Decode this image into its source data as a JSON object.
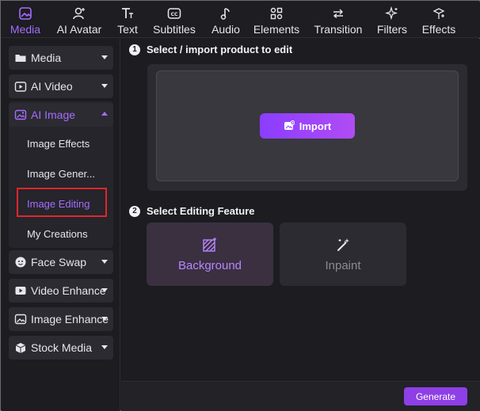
{
  "toolbar": {
    "tabs": [
      {
        "label": "Media",
        "icon": "media-icon",
        "active": true
      },
      {
        "label": "AI Avatar",
        "icon": "ai-avatar-icon"
      },
      {
        "label": "Text",
        "icon": "text-icon"
      },
      {
        "label": "Subtitles",
        "icon": "subtitles-icon"
      },
      {
        "label": "Audio",
        "icon": "audio-icon"
      },
      {
        "label": "Elements",
        "icon": "elements-icon"
      },
      {
        "label": "Transition",
        "icon": "transition-icon"
      },
      {
        "label": "Filters",
        "icon": "filters-icon"
      },
      {
        "label": "Effects",
        "icon": "effects-icon"
      }
    ]
  },
  "sidebar": {
    "items": [
      {
        "label": "Media",
        "icon": "folder-icon"
      },
      {
        "label": "AI Video",
        "icon": "ai-video-icon"
      },
      {
        "label": "AI Image",
        "icon": "ai-image-icon",
        "expanded": true
      },
      {
        "label": "Face Swap",
        "icon": "face-swap-icon"
      },
      {
        "label": "Video Enhance",
        "icon": "video-enhance-icon"
      },
      {
        "label": "Image Enhance",
        "icon": "image-enhance-icon"
      },
      {
        "label": "Stock Media",
        "icon": "stock-media-icon"
      }
    ],
    "subitems": [
      "Image Effects",
      "Image Gener...",
      "Image Editing",
      "My Creations"
    ],
    "selected_subitem": "Image Editing"
  },
  "main": {
    "step1": {
      "number": "1",
      "title": "Select / import product to edit"
    },
    "import_label": "Import",
    "step2": {
      "number": "2",
      "title": "Select Editing Feature"
    },
    "features": [
      {
        "label": "Background",
        "icon": "background-icon",
        "selected": true
      },
      {
        "label": "Inpaint",
        "icon": "magic-wand-icon",
        "selected": false
      }
    ]
  },
  "footer": {
    "generate_label": "Generate"
  },
  "colors": {
    "accent": "#a56cff",
    "highlight_border": "#e0262b",
    "button": "#8e3fe6"
  }
}
